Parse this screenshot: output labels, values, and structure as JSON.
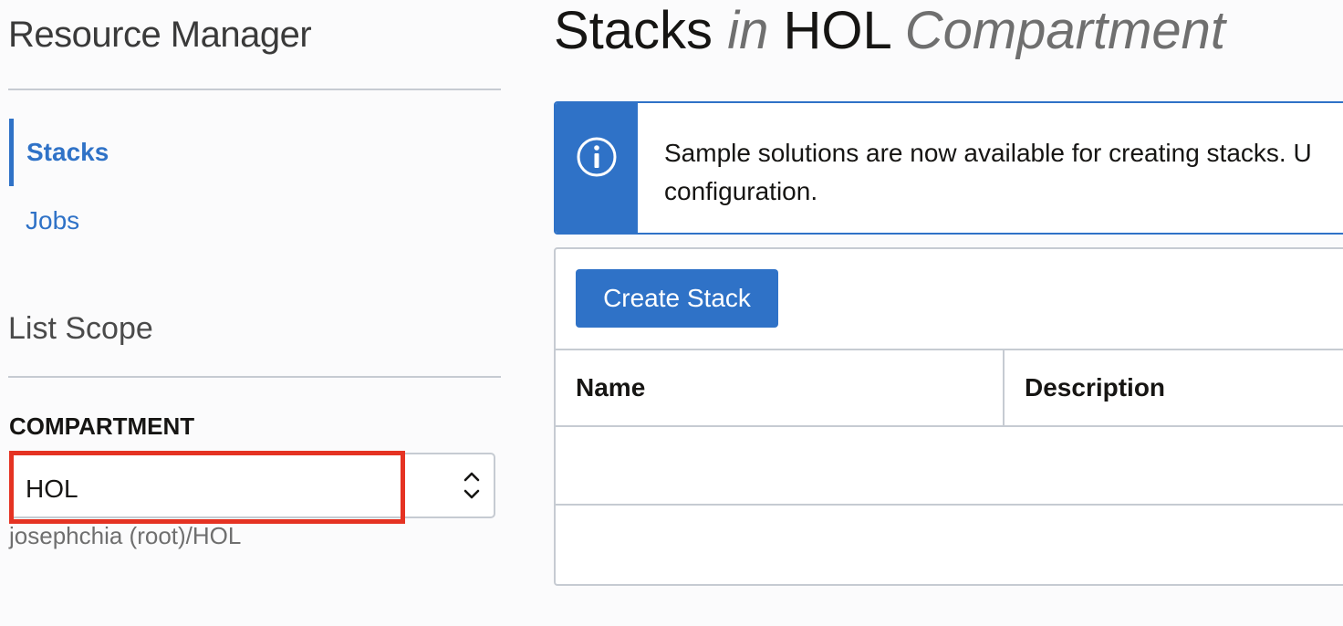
{
  "sidebar": {
    "title": "Resource Manager",
    "nav": [
      {
        "label": "Stacks",
        "active": true
      },
      {
        "label": "Jobs",
        "active": false
      }
    ],
    "list_scope": {
      "title": "List Scope",
      "compartment_label": "COMPARTMENT",
      "compartment_value": "HOL",
      "compartment_path": "josephchia (root)/HOL"
    }
  },
  "main": {
    "title": {
      "part1": "Stacks",
      "part2": "in",
      "part3": "HOL",
      "part4": "Compartment"
    },
    "info_banner": {
      "line1": "Sample solutions are now available for creating stacks. U",
      "line2": "configuration."
    },
    "create_button_label": "Create Stack",
    "table": {
      "columns": [
        "Name",
        "Description"
      ]
    }
  },
  "colors": {
    "accent": "#2f72c7",
    "highlight": "#e53323",
    "border": "#c6cbd2"
  }
}
